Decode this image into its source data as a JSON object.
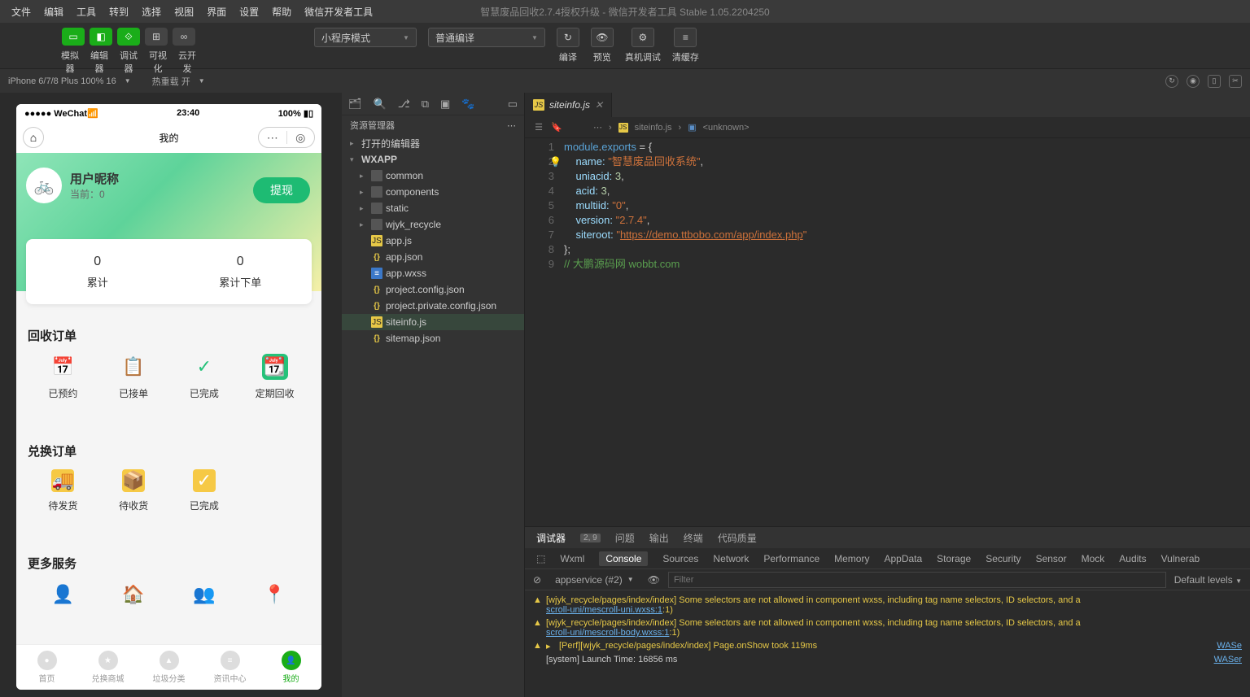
{
  "menubar": {
    "items": [
      "文件",
      "编辑",
      "工具",
      "转到",
      "选择",
      "视图",
      "界面",
      "设置",
      "帮助",
      "微信开发者工具"
    ],
    "title": "智慧废品回收2.7.4授权升级 - 微信开发者工具 Stable 1.05.2204250"
  },
  "toolbar": {
    "row1_labels": [
      "模拟器",
      "编辑器",
      "调试器",
      "可视化",
      "云开发"
    ],
    "dropdown1": "小程序模式",
    "dropdown2": "普通编译",
    "right_labels": [
      "编译",
      "预览",
      "真机调试",
      "清缓存"
    ]
  },
  "devicebar": {
    "device": "iPhone 6/7/8 Plus 100% 16",
    "reload": "热重载 开"
  },
  "simulator": {
    "status": {
      "left": "●●●●● WeChat",
      "wifi": "📶",
      "time": "23:40",
      "battery": "100%"
    },
    "nav_title": "我的",
    "user": {
      "name": "用户昵称",
      "sub": "当前：0",
      "withdraw": "提现"
    },
    "stats": [
      {
        "num": "0",
        "lab": "累计"
      },
      {
        "num": "0",
        "lab": "累计下单"
      }
    ],
    "sections": {
      "orders": {
        "title": "回收订单",
        "items": [
          "已预约",
          "已接单",
          "已完成",
          "定期回收"
        ]
      },
      "exchange": {
        "title": "兑换订单",
        "items": [
          "待发货",
          "待收货",
          "已完成"
        ]
      },
      "more": {
        "title": "更多服务"
      }
    },
    "tabbar": [
      "首页",
      "兑换商城",
      "垃圾分类",
      "资讯中心",
      "我的"
    ]
  },
  "explorer": {
    "title": "资源管理器",
    "open_editors": "打开的编辑器",
    "root": "WXAPP",
    "tree": [
      {
        "type": "folder",
        "name": "common"
      },
      {
        "type": "folder",
        "name": "components"
      },
      {
        "type": "folder",
        "name": "static"
      },
      {
        "type": "folder",
        "name": "wjyk_recycle"
      },
      {
        "type": "js",
        "name": "app.js"
      },
      {
        "type": "json",
        "name": "app.json"
      },
      {
        "type": "wxss",
        "name": "app.wxss"
      },
      {
        "type": "json",
        "name": "project.config.json"
      },
      {
        "type": "json",
        "name": "project.private.config.json"
      },
      {
        "type": "js",
        "name": "siteinfo.js",
        "active": true
      },
      {
        "type": "json",
        "name": "sitemap.json"
      }
    ]
  },
  "editor": {
    "tab": "siteinfo.js",
    "breadcrumb": {
      "file": "siteinfo.js",
      "sym": "<unknown>"
    },
    "code": {
      "l1a": "module",
      "l1b": ".",
      "l1c": "exports",
      "l1d": " = {",
      "l2a": "    name: ",
      "l2b": "\"智慧废品回收系统\"",
      "l2c": ",",
      "l3a": "    uniacid: ",
      "l3b": "3",
      "l3c": ",",
      "l4a": "    acid: ",
      "l4b": "3",
      "l4c": ",",
      "l5a": "    multiid: ",
      "l5b": "\"0\"",
      "l5c": ",",
      "l6a": "    version: ",
      "l6b": "\"2.7.4\"",
      "l6c": ",",
      "l7a": "    siteroot: ",
      "l7b": "\"",
      "l7c": "https://demo.ttbobo.com/app/index.php",
      "l7d": "\"",
      "l8": "};",
      "l9": "// 大鹏源码网 wobbt.com"
    }
  },
  "devtools": {
    "tabs1": [
      "调试器",
      "问题",
      "输出",
      "终端",
      "代码质量"
    ],
    "badge": "2, 9",
    "tabs2": [
      "Wxml",
      "Console",
      "Sources",
      "Network",
      "Performance",
      "Memory",
      "AppData",
      "Storage",
      "Security",
      "Sensor",
      "Mock",
      "Audits",
      "Vulnerab"
    ],
    "context": "appservice (#2)",
    "filter_placeholder": "Filter",
    "levels": "Default levels",
    "console": [
      {
        "type": "warn",
        "text": "[wjyk_recycle/pages/index/index] Some selectors are not allowed in component wxss, including tag name selectors, ID selectors, and a",
        "link": "scroll-uni/mescroll-uni.wxss:1",
        "suffix": ":1)"
      },
      {
        "type": "warn",
        "text": "[wjyk_recycle/pages/index/index] Some selectors are not allowed in component wxss, including tag name selectors, ID selectors, and a",
        "link": "scroll-uni/mescroll-body.wxss:1",
        "suffix": ":1)"
      },
      {
        "type": "warn",
        "tri": "▸",
        "text": "[Perf][wjyk_recycle/pages/index/index] Page.onShow took 119ms",
        "src": "WASe"
      },
      {
        "type": "log",
        "text": "[system] Launch Time: 16856 ms",
        "src": "WASer"
      }
    ]
  }
}
